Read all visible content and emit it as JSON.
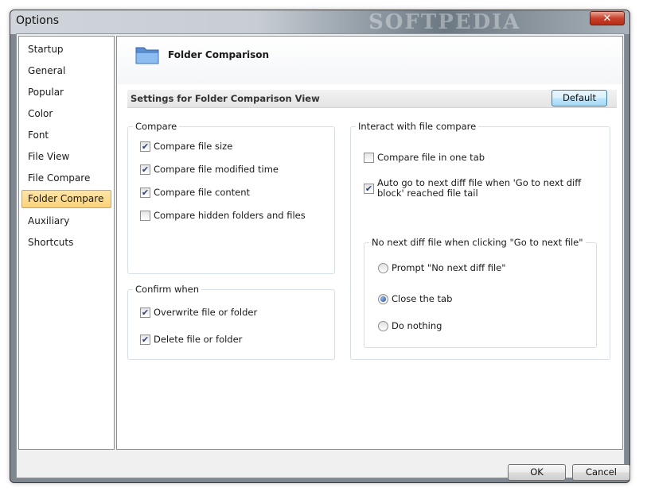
{
  "window": {
    "title": "Options",
    "watermark": "SOFTPEDIA",
    "close_label": "✕"
  },
  "sidebar": {
    "items": [
      {
        "label": "Startup",
        "selected": false
      },
      {
        "label": "General",
        "selected": false
      },
      {
        "label": "Popular",
        "selected": false
      },
      {
        "label": "Color",
        "selected": false
      },
      {
        "label": "Font",
        "selected": false
      },
      {
        "label": "File View",
        "selected": false
      },
      {
        "label": "File Compare",
        "selected": false
      },
      {
        "label": "Folder Compare",
        "selected": true
      },
      {
        "label": "Auxiliary",
        "selected": false
      },
      {
        "label": "Shortcuts",
        "selected": false
      }
    ]
  },
  "header": {
    "title": "Folder Comparison",
    "icon": "folder-icon"
  },
  "settings": {
    "label": "Settings for Folder Comparison View",
    "default_button": "Default"
  },
  "compare": {
    "title": "Compare",
    "options": [
      {
        "label": "Compare file size",
        "checked": true
      },
      {
        "label": "Compare file modified time",
        "checked": true
      },
      {
        "label": "Compare file content",
        "checked": true
      },
      {
        "label": "Compare hidden folders and files",
        "checked": false
      }
    ]
  },
  "confirm": {
    "title": "Confirm when",
    "options": [
      {
        "label": "Overwrite file or folder",
        "checked": true
      },
      {
        "label": "Delete file or folder",
        "checked": true
      }
    ]
  },
  "interact": {
    "title": "Interact with file compare",
    "options": [
      {
        "label": "Compare file in one tab",
        "checked": false
      },
      {
        "label": "Auto go to next diff file when 'Go to next diff block' reached file tail",
        "checked": true
      }
    ],
    "nonext": {
      "title": "No next diff file when clicking \"Go to next file\"",
      "options": [
        {
          "label": "Prompt \"No next diff file\"",
          "selected": false
        },
        {
          "label": "Close the tab",
          "selected": true
        },
        {
          "label": "Do nothing",
          "selected": false
        }
      ]
    }
  },
  "footer": {
    "ok": "OK",
    "cancel": "Cancel"
  },
  "colors": {
    "selected_bg": "#fbd27a",
    "selected_border": "#e3a33d",
    "accent": "#3c7fb1"
  }
}
